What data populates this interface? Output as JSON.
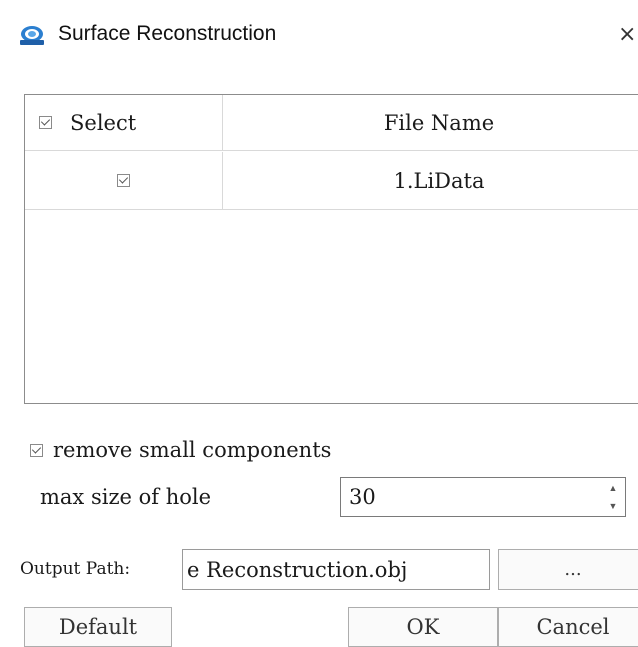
{
  "window": {
    "title": "Surface Reconstruction",
    "icon": "app-logo-icon",
    "close_glyph": "×"
  },
  "table": {
    "columns": [
      {
        "label": "Select"
      },
      {
        "label": "File Name"
      }
    ],
    "header_checked": true,
    "rows": [
      {
        "checked": true,
        "file_name": "1.LiData"
      }
    ]
  },
  "options": {
    "remove_small_components": {
      "label": "remove small components",
      "checked": true
    },
    "max_size_of_hole": {
      "label": "max size of hole",
      "value": "30"
    }
  },
  "output": {
    "label": "Output Path:",
    "value": "e Reconstruction.obj",
    "browse_label": "..."
  },
  "buttons": {
    "default": "Default",
    "ok": "OK",
    "cancel": "Cancel"
  }
}
